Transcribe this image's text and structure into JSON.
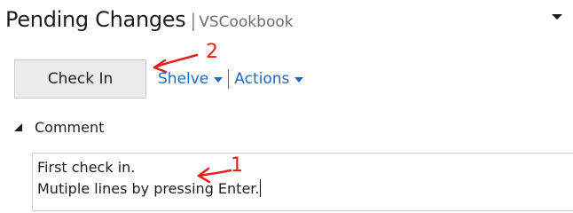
{
  "panel": {
    "title": "Pending Changes",
    "separator": "|",
    "subtitle": "VSCookbook"
  },
  "toolbar": {
    "checkin_label": "Check In",
    "shelve_label": "Shelve",
    "actions_label": "Actions"
  },
  "comment_section": {
    "label": "Comment",
    "lines": [
      "First check in.",
      "Mutiple lines by pressing Enter."
    ]
  },
  "annotations": {
    "marker_1": "1",
    "marker_2": "2",
    "color": "#e3201b"
  },
  "colors": {
    "link": "#1a6bc7",
    "button_bg": "#ececec",
    "text": "#1e1e1e"
  },
  "icons": [
    "panel-dropdown-icon",
    "shelve-caret-icon",
    "actions-caret-icon",
    "collapse-triangle-icon",
    "annotation-arrow-icon"
  ]
}
